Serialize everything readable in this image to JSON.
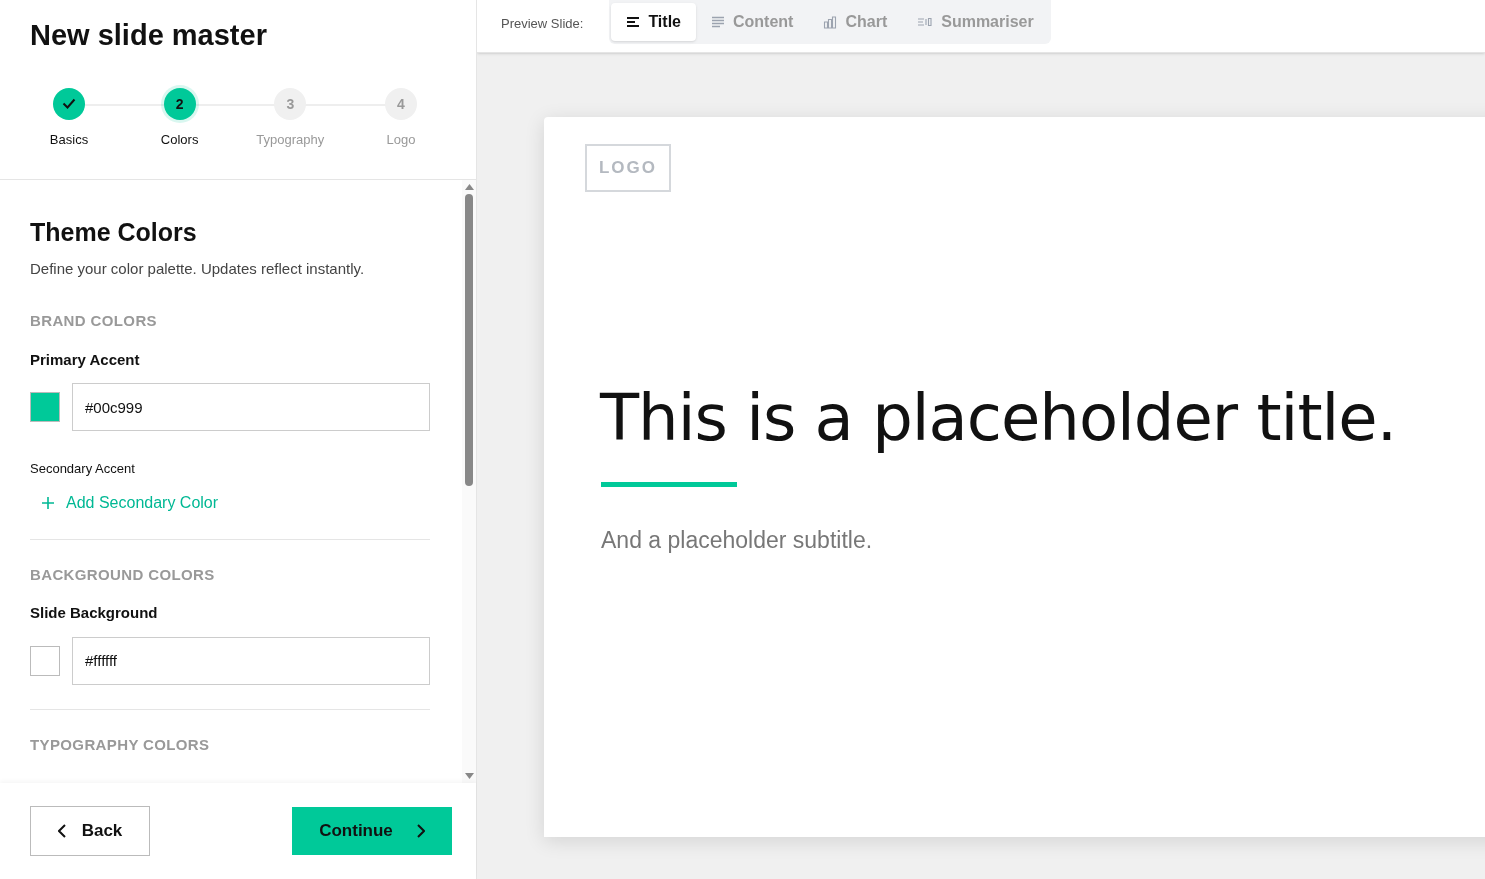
{
  "title": "New slide master",
  "steps": [
    {
      "label": "Basics",
      "completed": true,
      "selected": false
    },
    {
      "number": "2",
      "label": "Colors",
      "completed": false,
      "selected": true
    },
    {
      "number": "3",
      "label": "Typography",
      "completed": false,
      "selected": false
    },
    {
      "number": "4",
      "label": "Logo",
      "completed": false,
      "selected": false
    }
  ],
  "section": {
    "heading": "Theme Colors",
    "description": "Define your color palette. Updates reflect instantly."
  },
  "groups": [
    {
      "heading": "BRAND COLORS",
      "items": [
        {
          "kind": "color",
          "label": "Primary Accent",
          "value": "#00c999",
          "color": "#00c999"
        },
        {
          "kind": "add",
          "label": "Secondary Accent",
          "action": "Add Secondary Color"
        }
      ]
    },
    {
      "heading": "BACKGROUND COLORS",
      "items": [
        {
          "kind": "color",
          "label": "Slide Background",
          "value": "#ffffff",
          "color": "#ffffff"
        }
      ]
    },
    {
      "heading": "TYPOGRAPHY COLORS"
    }
  ],
  "footer": {
    "back": "Back",
    "continue": "Continue"
  },
  "preview": {
    "label": "Preview Slide:",
    "tabs": [
      {
        "kind": "title",
        "label": "Title",
        "selected": true
      },
      {
        "kind": "content",
        "label": "Content",
        "selected": false
      },
      {
        "kind": "chart",
        "label": "Chart",
        "selected": false
      },
      {
        "kind": "summary",
        "label": "Summariser",
        "selected": false
      }
    ]
  },
  "slide": {
    "logo": "LOGO",
    "title": "This is a placeholder title.",
    "subtitle": "And a placeholder subtitle."
  }
}
